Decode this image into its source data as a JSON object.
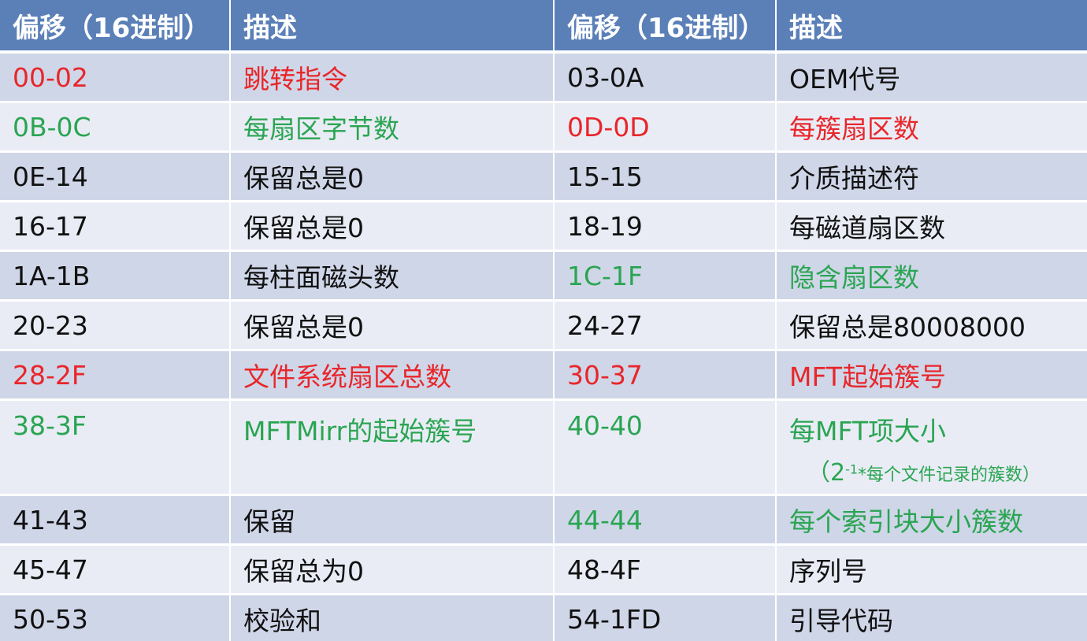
{
  "table": {
    "headers": [
      "偏移（16进制）",
      "描述",
      "偏移（16进制）",
      "描述"
    ],
    "colors": {
      "header_bg": "#5b80b8",
      "row_dark": "#cfd6e8",
      "row_light": "#e9ecf5",
      "red": "#e8262a",
      "green": "#2aa552",
      "black": "#111111"
    },
    "rows": [
      {
        "off1": "00-02",
        "desc1": "跳转指令",
        "off2": "03-0A",
        "desc2": "OEM代号",
        "color1": "red",
        "color2": "black"
      },
      {
        "off1": "0B-0C",
        "desc1": "每扇区字节数",
        "off2": "0D-0D",
        "desc2": "每簇扇区数",
        "color1": "green",
        "color2": "red"
      },
      {
        "off1": "0E-14",
        "desc1": "保留总是0",
        "off2": "15-15",
        "desc2": "介质描述符",
        "color1": "black",
        "color2": "black"
      },
      {
        "off1": "16-17",
        "desc1": "保留总是0",
        "off2": "18-19",
        "desc2": "每磁道扇区数",
        "color1": "black",
        "color2": "black"
      },
      {
        "off1": "1A-1B",
        "desc1": "每柱面磁头数",
        "off2": "1C-1F",
        "desc2": "隐含扇区数",
        "color1": "black",
        "color2": "green"
      },
      {
        "off1": "20-23",
        "desc1": "保留总是0",
        "off2": "24-27",
        "desc2": "保留总是80008000",
        "color1": "black",
        "color2": "black"
      },
      {
        "off1": "28-2F",
        "desc1": "文件系统扇区总数",
        "off2": "30-37",
        "desc2": "MFT起始簇号",
        "color1": "red",
        "color2": "red"
      },
      {
        "off1": "38-3F",
        "desc1": "MFTMirr的起始簇号",
        "off2": "40-40",
        "desc2": "每MFT项大小",
        "color1": "green",
        "color2": "green",
        "note": {
          "open": "（",
          "base": "2",
          "exp": "-1",
          "rest": "*每个文件记录的簇数）"
        }
      },
      {
        "off1": "41-43",
        "desc1": "保留",
        "off2": "44-44",
        "desc2": "每个索引块大小簇数",
        "color1": "black",
        "color2": "green"
      },
      {
        "off1": "45-47",
        "desc1": "保留总为0",
        "off2": "48-4F",
        "desc2": "序列号",
        "color1": "black",
        "color2": "black"
      },
      {
        "off1": "50-53",
        "desc1": "校验和",
        "off2": "54-1FD",
        "desc2": "引导代码",
        "color1": "black",
        "color2": "black"
      }
    ]
  }
}
